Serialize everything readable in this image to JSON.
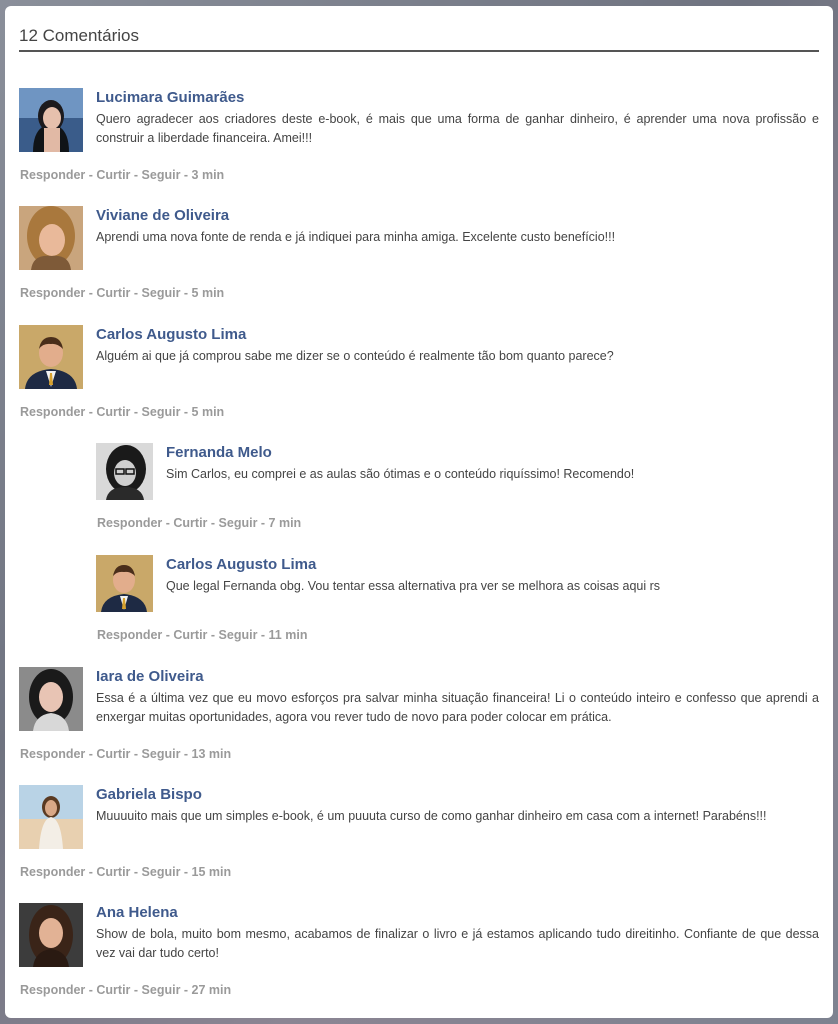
{
  "header": {
    "title": "12 Comentários"
  },
  "comments": [
    {
      "name": "Lucimara Guimarães",
      "text": "Quero agradecer aos criadores deste e-book, é mais que uma forma de ganhar dinheiro, é aprender uma nova profissão e construir a liberdade financeira. Amei!!!",
      "actions": "Responder - Curtir - Seguir - 3 min"
    },
    {
      "name": "Viviane de Oliveira",
      "text": "Aprendi uma nova fonte de renda e já indiquei para minha amiga. Excelente custo benefício!!!",
      "actions": "Responder - Curtir - Seguir - 5 min"
    },
    {
      "name": "Carlos Augusto Lima",
      "text": "Alguém ai que já comprou sabe me dizer se o conteúdo é realmente tão bom quanto parece?",
      "actions": "Responder - Curtir - Seguir - 5 min"
    },
    {
      "name": "Fernanda Melo",
      "text": "Sim Carlos, eu comprei e as aulas são ótimas e o conteúdo riquíssimo! Recomendo!",
      "actions": "Responder - Curtir - Seguir - 7 min"
    },
    {
      "name": "Carlos Augusto Lima",
      "text": "Que legal Fernanda obg. Vou tentar essa alternativa pra ver se melhora as coisas aqui rs",
      "actions": "Responder - Curtir - Seguir - 11 min"
    },
    {
      "name": "Iara de Oliveira",
      "text": "Essa é a última vez que eu movo esforços pra salvar minha situação financeira! Li o conteúdo inteiro e confesso que aprendi a enxergar muitas oportunidades, agora vou rever tudo de novo para poder colocar em prática.",
      "actions": "Responder - Curtir - Seguir - 13 min"
    },
    {
      "name": "Gabriela Bispo",
      "text": "Muuuuito mais que um simples e-book, é um puuuta curso de como ganhar dinheiro em casa com a internet! Parabéns!!!",
      "actions": "Responder - Curtir - Seguir - 15 min"
    },
    {
      "name": "Ana Helena",
      "text": "Show de bola, muito bom mesmo, acabamos de finalizar o livro e já estamos aplicando tudo direitinho. Confiante de que dessa vez vai dar tudo certo!",
      "actions": "Responder - Curtir - Seguir - 27 min"
    }
  ],
  "colors": {
    "name": "#3f5a8c",
    "actions": "#9a9a9a",
    "text": "#444444"
  }
}
